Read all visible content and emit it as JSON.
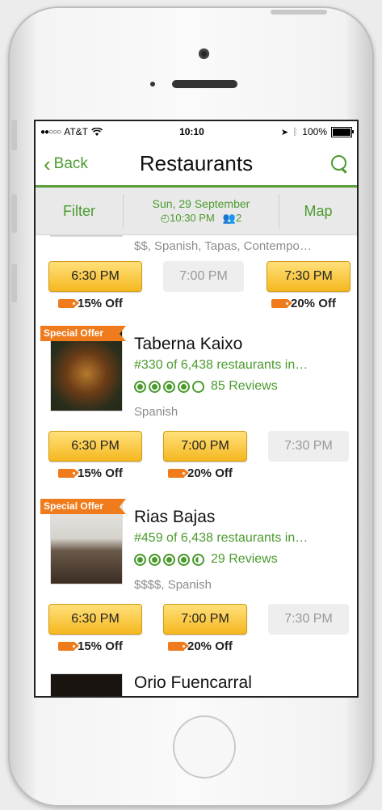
{
  "status_bar": {
    "carrier": "AT&T",
    "time": "10:10",
    "battery": "100%"
  },
  "nav": {
    "back_label": "Back",
    "title": "Restaurants"
  },
  "filter_bar": {
    "filter_label": "Filter",
    "date": "Sun, 29 September",
    "time": "10:30 PM",
    "party_size": "2",
    "map_label": "Map"
  },
  "restaurants": [
    {
      "tags": "$$, Spanish, Tapas, Contempo…",
      "slots": [
        {
          "time": "6:30 PM",
          "available": true,
          "discount": "15% Off"
        },
        {
          "time": "7:00 PM",
          "available": false,
          "discount": ""
        },
        {
          "time": "7:30 PM",
          "available": true,
          "discount": "20% Off"
        }
      ]
    },
    {
      "badge": "Special Offer",
      "name": "Taberna Kaixo",
      "rank": "#330 of 6,438 restaurants in…",
      "rating": 4.0,
      "reviews": "85 Reviews",
      "tags": "Spanish",
      "slots": [
        {
          "time": "6:30 PM",
          "available": true,
          "discount": "15% Off"
        },
        {
          "time": "7:00 PM",
          "available": true,
          "discount": "20% Off"
        },
        {
          "time": "7:30 PM",
          "available": false,
          "discount": ""
        }
      ]
    },
    {
      "badge": "Special Offer",
      "name": "Rias Bajas",
      "rank": "#459 of 6,438 restaurants in…",
      "rating": 4.5,
      "reviews": "29 Reviews",
      "tags": "$$$$, Spanish",
      "slots": [
        {
          "time": "6:30 PM",
          "available": true,
          "discount": "15% Off"
        },
        {
          "time": "7:00 PM",
          "available": true,
          "discount": "20% Off"
        },
        {
          "time": "7:30 PM",
          "available": false,
          "discount": ""
        }
      ]
    },
    {
      "name": "Orio Fuencarral"
    }
  ],
  "colors": {
    "accent": "#4b9a2e",
    "offer": "#f07b1c",
    "slot": "#f5b820"
  }
}
